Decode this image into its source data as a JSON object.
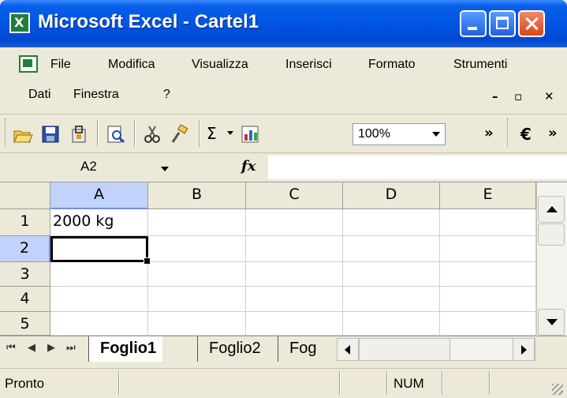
{
  "window": {
    "title": "Microsoft Excel - Cartel1"
  },
  "menu": {
    "items": [
      "File",
      "Modifica",
      "Visualizza",
      "Inserisci",
      "Formato",
      "Strumenti",
      "Dati",
      "Finestra",
      "?"
    ]
  },
  "toolbar": {
    "zoom": "100%",
    "currency_symbol": "€",
    "more": "»"
  },
  "formula_bar": {
    "name_box": "A2",
    "fx_label": "fx",
    "value": ""
  },
  "grid": {
    "columns": [
      "A",
      "B",
      "C",
      "D",
      "E"
    ],
    "rows": [
      "1",
      "2",
      "3",
      "4",
      "5"
    ],
    "cells": {
      "A1": "2000 kg"
    },
    "active_cell": "A2"
  },
  "sheets": {
    "tabs": [
      "Foglio1",
      "Foglio2",
      "Fog"
    ],
    "active": "Foglio1"
  },
  "status": {
    "text": "Pronto",
    "num": "NUM"
  }
}
